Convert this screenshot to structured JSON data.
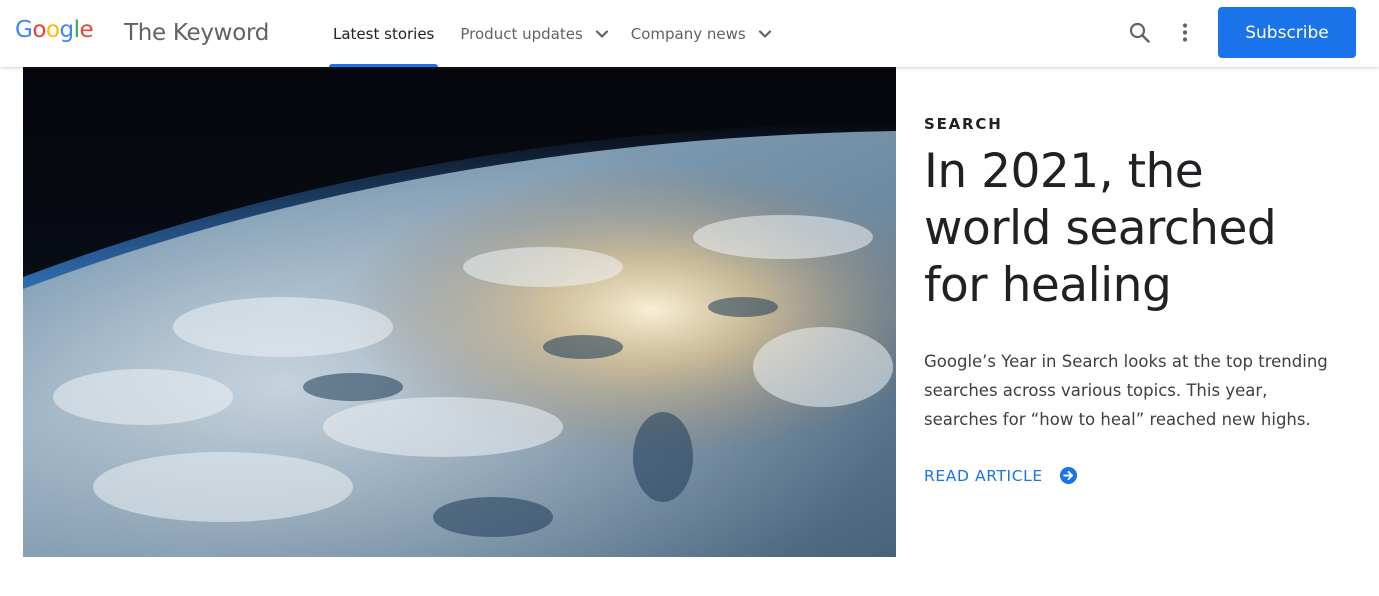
{
  "header": {
    "logo_letters": [
      "G",
      "o",
      "o",
      "g",
      "l",
      "e"
    ],
    "site_name": "The Keyword",
    "nav": [
      {
        "label": "Latest stories",
        "active": true
      },
      {
        "label": "Product updates",
        "dropdown": true
      },
      {
        "label": "Company news",
        "dropdown": true
      }
    ],
    "search_icon": "search-icon",
    "more_icon": "more-vert-icon",
    "subscribe_label": "Subscribe"
  },
  "hero": {
    "image_subject": "earth-from-orbit",
    "category": "SEARCH",
    "headline": "In 2021, the world searched for healing",
    "summary": "Google’s Year in Search looks at the top trending searches across various topics. This year, searches for “how to heal” reached new highs.",
    "cta_label": "READ ARTICLE",
    "cta_icon": "arrow-right-circle-icon"
  },
  "colors": {
    "accent": "#1a73e8",
    "text": "#202124",
    "muted": "#5f6368",
    "logo_blue": "#4285f4",
    "logo_red": "#ea4335",
    "logo_yellow": "#fbbc05",
    "logo_green": "#34a853"
  }
}
